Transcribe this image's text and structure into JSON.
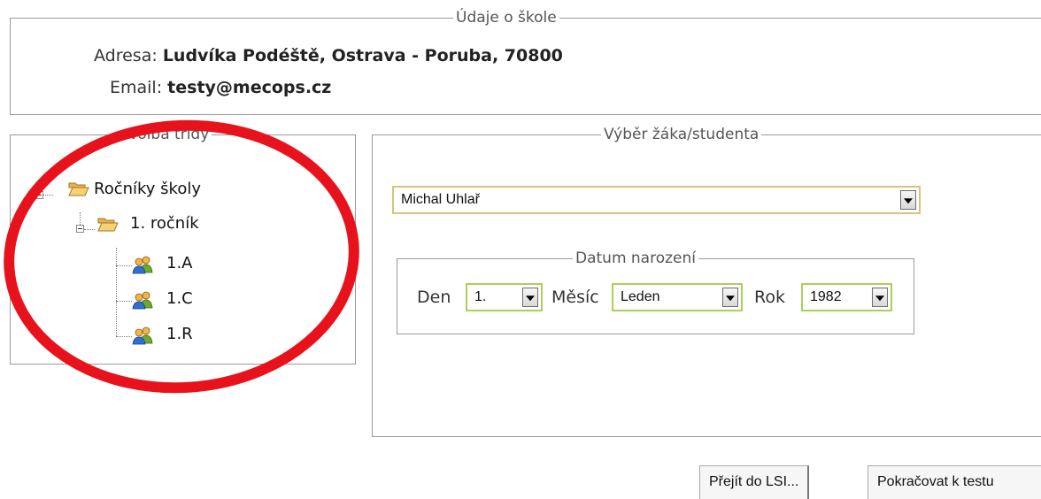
{
  "school": {
    "legend": "Údaje o škole",
    "address_label": "Adresa:",
    "address_value": "Ludvíka Podéště, Ostrava - Poruba, 70800",
    "email_label": "Email:",
    "email_value": "testy@mecops.cz"
  },
  "classes": {
    "legend": "Volba třídy",
    "tree": {
      "root": "Ročníky školy",
      "grade": "1. ročník",
      "items": [
        "1.A",
        "1.C",
        "1.R"
      ]
    }
  },
  "student": {
    "legend": "Výběr žáka/studenta",
    "selected": "Michal Uhlař",
    "birth": {
      "legend": "Datum narození",
      "day_label": "Den",
      "day_value": "1.",
      "month_label": "Měsíc",
      "month_value": "Leden",
      "year_label": "Rok",
      "year_value": "1982"
    }
  },
  "buttons": {
    "lsi": "Přejít do LSI...",
    "continue": "Pokračovat k testu"
  },
  "colors": {
    "annotation": "#e8121c",
    "select_border_main": "#d8c37a",
    "select_border_small": "#a9d15a",
    "folder": "#f2c15a"
  }
}
